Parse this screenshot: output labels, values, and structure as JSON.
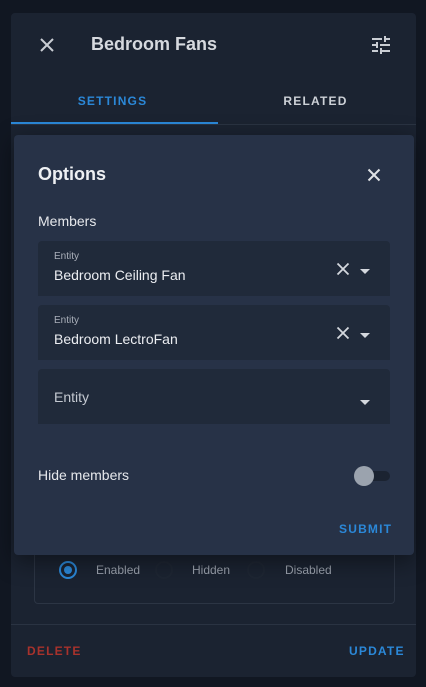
{
  "dialog": {
    "title": "Bedroom Fans",
    "close_icon": "close-icon",
    "settings_icon": "tune-icon",
    "tabs": [
      {
        "label": "SETTINGS",
        "active": true
      },
      {
        "label": "RELATED",
        "active": false
      }
    ],
    "visibility": {
      "options": [
        {
          "label": "Enabled",
          "checked": true
        },
        {
          "label": "Hidden",
          "checked": false
        },
        {
          "label": "Disabled",
          "checked": false
        }
      ]
    },
    "footer": {
      "delete_label": "DELETE",
      "update_label": "UPDATE"
    }
  },
  "modal": {
    "title": "Options",
    "members_label": "Members",
    "members": [
      {
        "label": "Entity",
        "value": "Bedroom Ceiling Fan"
      },
      {
        "label": "Entity",
        "value": "Bedroom LectroFan"
      }
    ],
    "empty_entity_placeholder": "Entity",
    "hide_members_label": "Hide members",
    "hide_members_on": false,
    "submit_label": "SUBMIT"
  },
  "colors": {
    "accent": "#2b88d8",
    "danger": "#a8322c",
    "surface": "#1b2331",
    "modal_surface": "#273247"
  }
}
